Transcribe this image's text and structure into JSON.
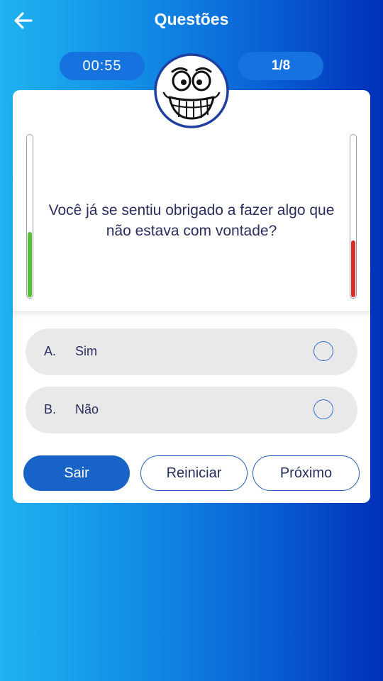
{
  "header": {
    "title": "Questões",
    "back_icon": "arrow-left-icon"
  },
  "status": {
    "timer": "00:55",
    "progress": "1/8"
  },
  "mascot": {
    "icon": "grinning-face-icon"
  },
  "question": {
    "text": "Você já se sentiu obrigado a fazer algo que não estava com vontade?",
    "left_meter_level": 0.4,
    "left_meter_color": "#52c234",
    "right_meter_level": 0.35,
    "right_meter_color": "#e02a2a"
  },
  "options": [
    {
      "letter": "A.",
      "label": "Sim",
      "selected": false
    },
    {
      "letter": "B.",
      "label": "Não",
      "selected": false
    }
  ],
  "buttons": {
    "exit": "Sair",
    "restart": "Reiniciar",
    "next": "Próximo"
  },
  "colors": {
    "primary": "#1763c8",
    "text": "#2a2e5e"
  }
}
